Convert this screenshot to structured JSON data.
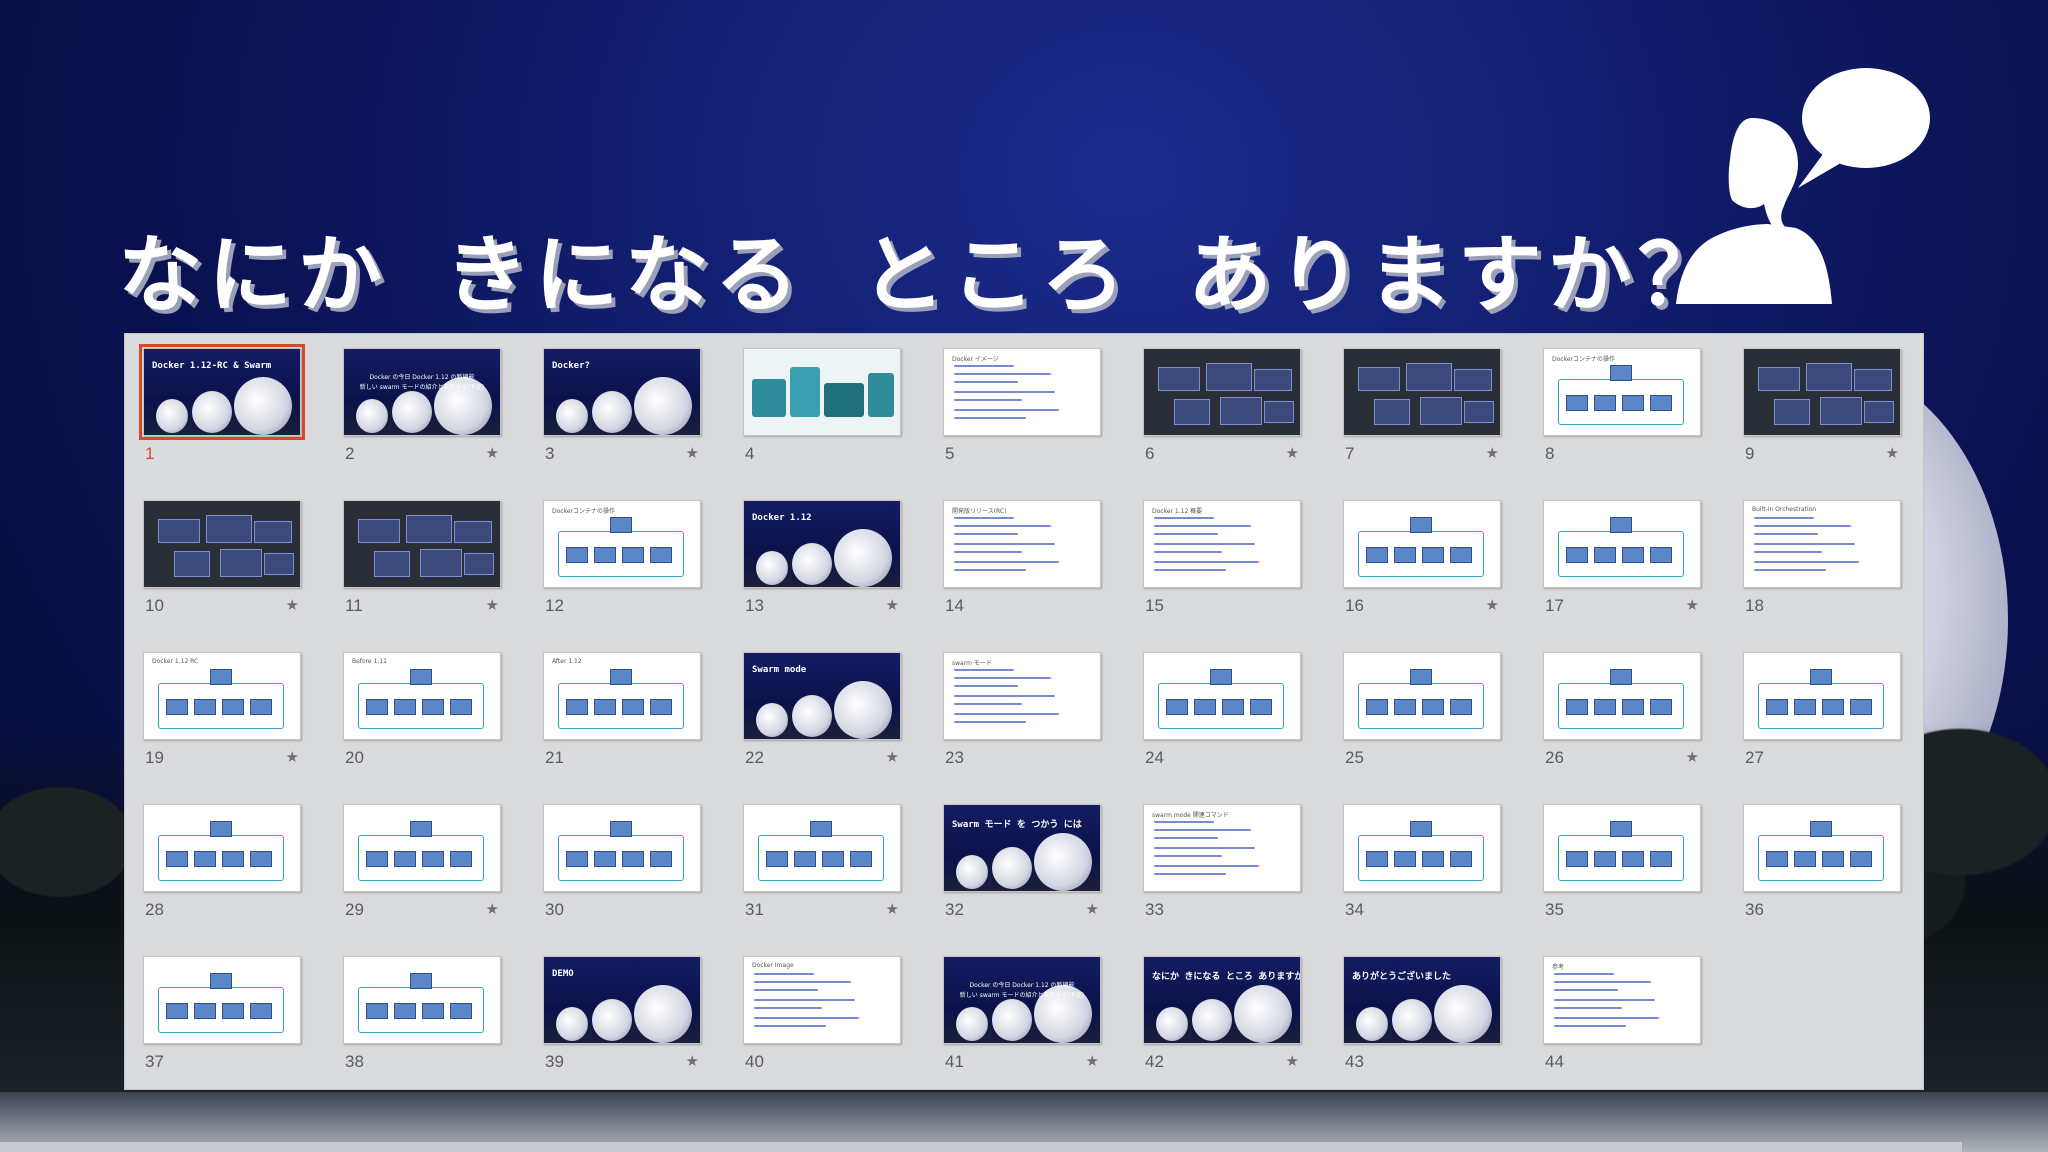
{
  "title": "なにか きになる ところ ありますか？",
  "icons": {
    "speaker": "person-speech-bubble-icon",
    "star": "star-icon"
  },
  "colors": {
    "selected": "#d64a2c",
    "panel": "#dadbdd"
  },
  "slides": [
    {
      "num": "1",
      "selected": true,
      "star": false,
      "kind": "dark",
      "text": "Docker 1.12-RC & Swarm"
    },
    {
      "num": "2",
      "star": true,
      "kind": "darktext",
      "lines": [
        "Docker の今日 Docker 1.12 の新機能",
        "新しい swarm モードの紹介と事例デモ(予定)"
      ]
    },
    {
      "num": "3",
      "star": true,
      "kind": "dark",
      "text": "Docker?"
    },
    {
      "num": "4",
      "star": false,
      "kind": "infra"
    },
    {
      "num": "5",
      "star": false,
      "kind": "white",
      "heading": "Docker イメージ"
    },
    {
      "num": "6",
      "star": true,
      "kind": "slate"
    },
    {
      "num": "7",
      "star": true,
      "kind": "slate"
    },
    {
      "num": "8",
      "star": false,
      "kind": "diagram",
      "heading": "Dockerコンテナの操作"
    },
    {
      "num": "9",
      "star": true,
      "kind": "slate"
    },
    {
      "num": "10",
      "star": true,
      "kind": "slate"
    },
    {
      "num": "11",
      "star": true,
      "kind": "slate"
    },
    {
      "num": "12",
      "star": false,
      "kind": "diagram",
      "heading": "Dockerコンテナの操作"
    },
    {
      "num": "13",
      "star": true,
      "kind": "dark",
      "text": "Docker 1.12"
    },
    {
      "num": "14",
      "star": false,
      "kind": "white",
      "heading": "開発版リリース(RC)"
    },
    {
      "num": "15",
      "star": false,
      "kind": "white",
      "heading": "Docker 1.12 概要"
    },
    {
      "num": "16",
      "star": true,
      "kind": "diagram"
    },
    {
      "num": "17",
      "star": true,
      "kind": "diagram"
    },
    {
      "num": "18",
      "star": false,
      "kind": "white",
      "heading": "Built-in Orchestration"
    },
    {
      "num": "19",
      "star": true,
      "kind": "diagram",
      "heading": "Docker 1.12 RC"
    },
    {
      "num": "20",
      "star": false,
      "kind": "diagram",
      "heading": "Before 1.11"
    },
    {
      "num": "21",
      "star": false,
      "kind": "diagram",
      "heading": "After 1.12"
    },
    {
      "num": "22",
      "star": true,
      "kind": "dark",
      "text": "Swarm mode"
    },
    {
      "num": "23",
      "star": false,
      "kind": "white",
      "heading": "swarm モード"
    },
    {
      "num": "24",
      "star": false,
      "kind": "diagram"
    },
    {
      "num": "25",
      "star": false,
      "kind": "diagram"
    },
    {
      "num": "26",
      "star": true,
      "kind": "diagram"
    },
    {
      "num": "27",
      "star": false,
      "kind": "diagram"
    },
    {
      "num": "28",
      "star": false,
      "kind": "diagram"
    },
    {
      "num": "29",
      "star": true,
      "kind": "diagram"
    },
    {
      "num": "30",
      "star": false,
      "kind": "diagram"
    },
    {
      "num": "31",
      "star": true,
      "kind": "diagram"
    },
    {
      "num": "32",
      "star": true,
      "kind": "dark",
      "text": "Swarm モード を つかう には"
    },
    {
      "num": "33",
      "star": false,
      "kind": "white",
      "heading": "swarm mode 関連コマンド"
    },
    {
      "num": "34",
      "star": false,
      "kind": "diagram"
    },
    {
      "num": "35",
      "star": false,
      "kind": "diagram"
    },
    {
      "num": "36",
      "star": false,
      "kind": "diagram"
    },
    {
      "num": "37",
      "star": false,
      "kind": "diagram"
    },
    {
      "num": "38",
      "star": false,
      "kind": "diagram"
    },
    {
      "num": "39",
      "star": true,
      "kind": "dark",
      "text": "DEMO"
    },
    {
      "num": "40",
      "star": false,
      "kind": "white",
      "heading": "Docker Image"
    },
    {
      "num": "41",
      "star": true,
      "kind": "darktext",
      "lines": [
        "Docker の今日 Docker 1.12 の新機能",
        "新しい swarm モードの紹介と事例デモ(予定)"
      ]
    },
    {
      "num": "42",
      "star": true,
      "kind": "dark",
      "text": "なにか きになる ところ ありますか？"
    },
    {
      "num": "43",
      "star": false,
      "kind": "dark",
      "text": "ありがとうございました"
    },
    {
      "num": "44",
      "star": false,
      "kind": "white",
      "heading": "参考"
    }
  ]
}
